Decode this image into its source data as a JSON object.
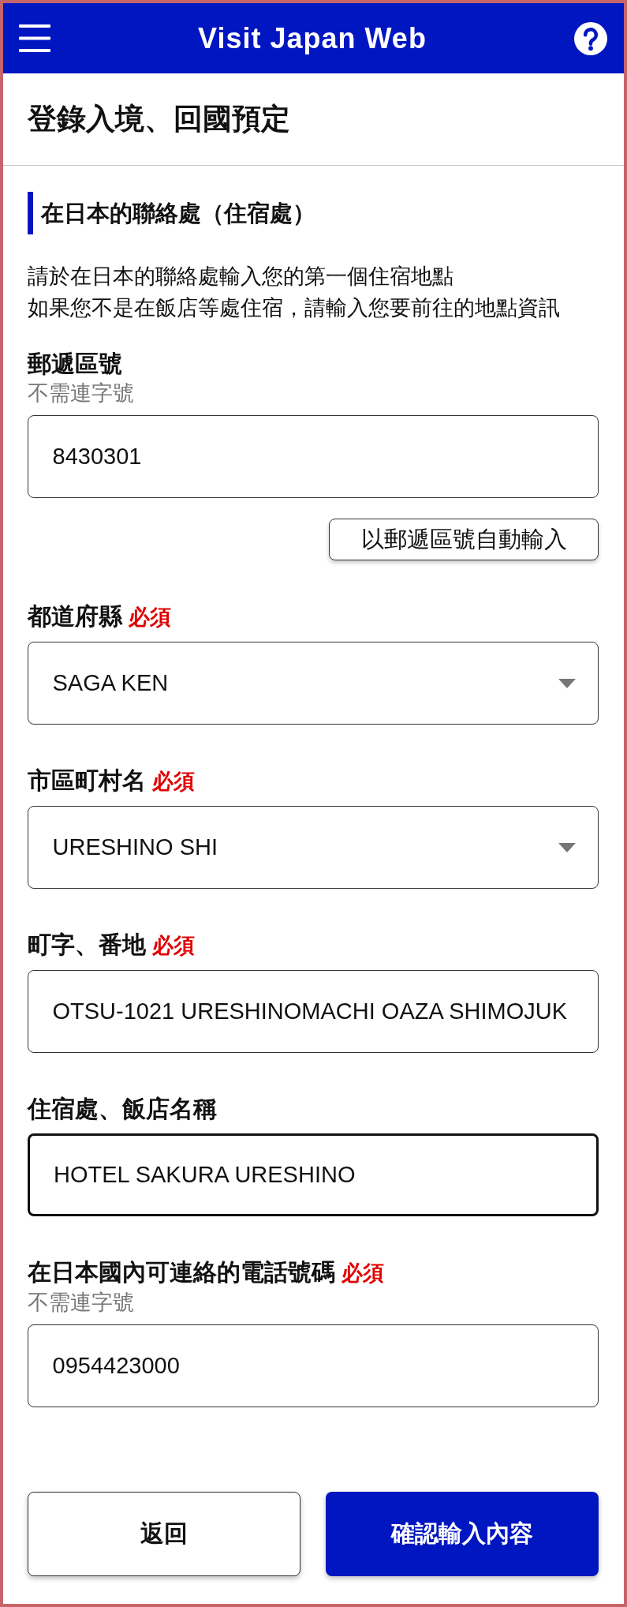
{
  "header": {
    "title": "Visit Japan Web"
  },
  "page_title": "登錄入境、回國預定",
  "section": {
    "heading": "在日本的聯絡處（住宿處）",
    "description": [
      "請於在日本的聯絡處輸入您的第一個住宿地點",
      "如果您不是在飯店等處住宿，請輸入您要前往的地點資訊"
    ]
  },
  "fields": [
    {
      "kind": "text",
      "label": "郵遞區號",
      "hint": "不需連字號",
      "value": "8430301",
      "focused": false,
      "action": "以郵遞區號自動輸入"
    },
    {
      "kind": "select",
      "label": "都道府縣",
      "required": "必須",
      "value": "SAGA KEN",
      "focused": false
    },
    {
      "kind": "select",
      "label": "市區町村名",
      "required": "必須",
      "value": "URESHINO SHI",
      "focused": false
    },
    {
      "kind": "text",
      "label": "町字、番地",
      "required": "必須",
      "value": "OTSU-1021 URESHINOMACHI OAZA SHIMOJUK",
      "focused": false
    },
    {
      "kind": "text",
      "label": "住宿處、飯店名稱",
      "value": "HOTEL SAKURA URESHINO",
      "focused": true
    },
    {
      "kind": "text",
      "label": "在日本國內可連絡的電話號碼",
      "required": "必須",
      "hint": "不需連字號",
      "value": "0954423000",
      "focused": false
    }
  ],
  "buttons": [
    {
      "kind": "secondary",
      "label": "返回"
    },
    {
      "kind": "primary",
      "label": "確認輸入內容"
    }
  ]
}
